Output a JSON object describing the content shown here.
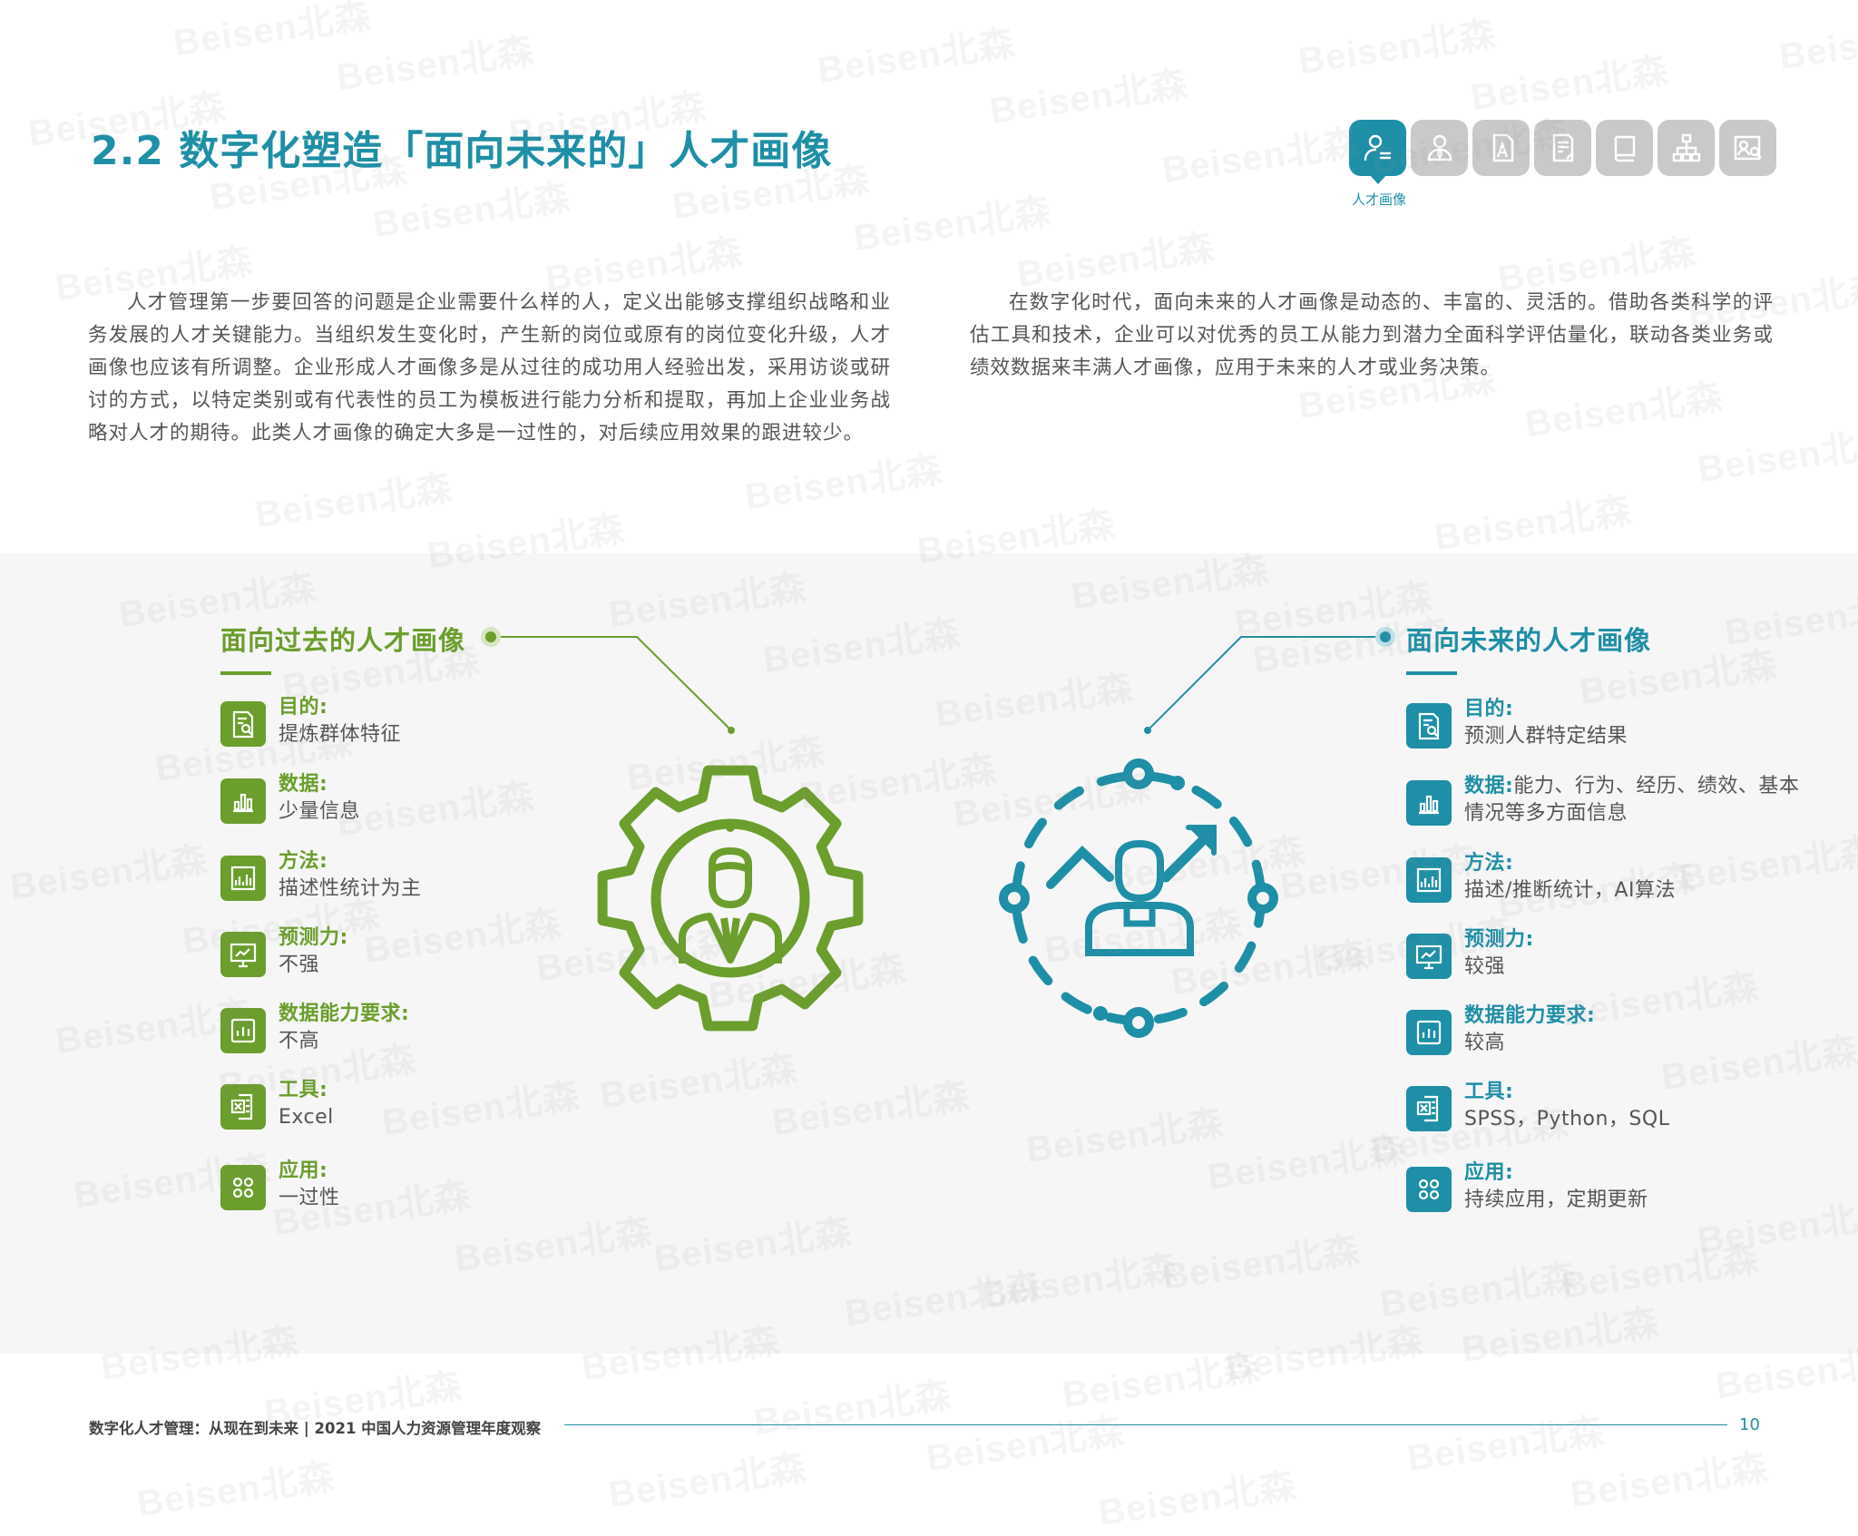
{
  "header": {
    "title": "2.2 数字化塑造「面向未来的」人才画像",
    "nav_active_label": "人才画像",
    "nav_icons": [
      "person-profile-icon",
      "user-icon",
      "text-a-icon",
      "document-edit-icon",
      "book-icon",
      "org-chart-icon",
      "profile-search-icon"
    ]
  },
  "intro": {
    "left": "人才管理第一步要回答的问题是企业需要什么样的人，定义出能够支撑组织战略和业务发展的人才关键能力。当组织发生变化时，产生新的岗位或原有的岗位变化升级，人才画像也应该有所调整。企业形成人才画像多是从过往的成功用人经验出发，采用访谈或研讨的方式，以特定类别或有代表性的员工为模板进行能力分析和提取，再加上企业业务战略对人才的期待。此类人才画像的确定大多是一过性的，对后续应用效果的跟进较少。",
    "right": "在数字化时代，面向未来的人才画像是动态的、丰富的、灵活的。借助各类科学的评估工具和技术，企业可以对优秀的员工从能力到潜力全面科学评估量化，联动各类业务或绩效数据来丰满人才画像，应用于未来的人才或业务决策。"
  },
  "past": {
    "title": "面向过去的人才画像",
    "items": [
      {
        "label": "目的:",
        "value": "提炼群体特征"
      },
      {
        "label": "数据:",
        "value": "少量信息"
      },
      {
        "label": "方法:",
        "value": "描述性统计为主"
      },
      {
        "label": "预测力:",
        "value": "不强"
      },
      {
        "label": "数据能力要求:",
        "value": "不高"
      },
      {
        "label": "工具:",
        "value": "Excel"
      },
      {
        "label": "应用:",
        "value": "一过性"
      }
    ]
  },
  "future": {
    "title": "面向未来的人才画像",
    "items": [
      {
        "label": "目的:",
        "value": "预测人群特定结果"
      },
      {
        "label": "数据:",
        "value": "能力、行为、经历、绩效、基本情况等多方面信息"
      },
      {
        "label": "方法:",
        "value": "描述/推断统计，AI算法"
      },
      {
        "label": "预测力:",
        "value": "较强"
      },
      {
        "label": "数据能力要求:",
        "value": "较高"
      },
      {
        "label": "工具:",
        "value": "SPSS，Python，SQL"
      },
      {
        "label": "应用:",
        "value": "持续应用，定期更新"
      }
    ]
  },
  "footer": {
    "text": "数字化人才管理：从现在到未来 | 2021 中国人力资源管理年度观察",
    "page": "10"
  },
  "watermark": "Beisen北森",
  "colors": {
    "teal": "#1e8fa6",
    "green": "#6b9e2c",
    "panel": "#f6f6f6",
    "nav_inactive": "#c9c9c9"
  }
}
